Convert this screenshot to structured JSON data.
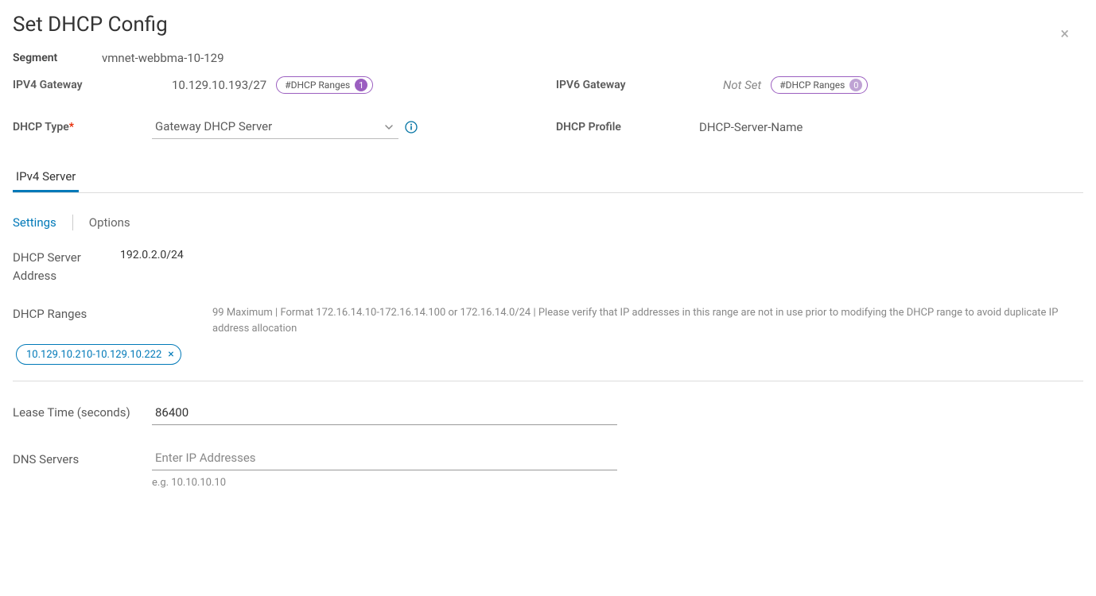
{
  "title": "Set DHCP Config",
  "segment": {
    "label": "Segment",
    "value": "vmnet-webbma-10-129"
  },
  "ipv4_gateway": {
    "label": "IPV4 Gateway",
    "value": "10.129.10.193/27",
    "ranges_pill_label": "#DHCP Ranges",
    "ranges_count": "1"
  },
  "ipv6_gateway": {
    "label": "IPV6 Gateway",
    "value": "Not Set",
    "ranges_pill_label": "#DHCP Ranges",
    "ranges_count": "0"
  },
  "dhcp_type": {
    "label": "DHCP Type",
    "value": "Gateway DHCP Server"
  },
  "dhcp_profile": {
    "label": "DHCP Profile",
    "value": "DHCP-Server-Name"
  },
  "tabs": [
    {
      "label": "IPv4 Server",
      "active": true
    }
  ],
  "subtabs": {
    "settings": "Settings",
    "options": "Options"
  },
  "settings": {
    "dhcp_server_address": {
      "label": "DHCP Server Address",
      "value": "192.0.2.0/24"
    },
    "dhcp_ranges": {
      "label": "DHCP Ranges",
      "help": "99 Maximum | Format 172.16.14.10-172.16.14.100 or 172.16.14.0/24 | Please verify that IP addresses in this range are not in use prior to modifying the DHCP range to avoid duplicate IP address allocation",
      "tags": [
        "10.129.10.210-10.129.10.222"
      ]
    },
    "lease_time": {
      "label": "Lease Time (seconds)",
      "value": "86400"
    },
    "dns_servers": {
      "label": "DNS Servers",
      "placeholder": "Enter IP Addresses",
      "hint": "e.g. 10.10.10.10",
      "value": ""
    }
  }
}
